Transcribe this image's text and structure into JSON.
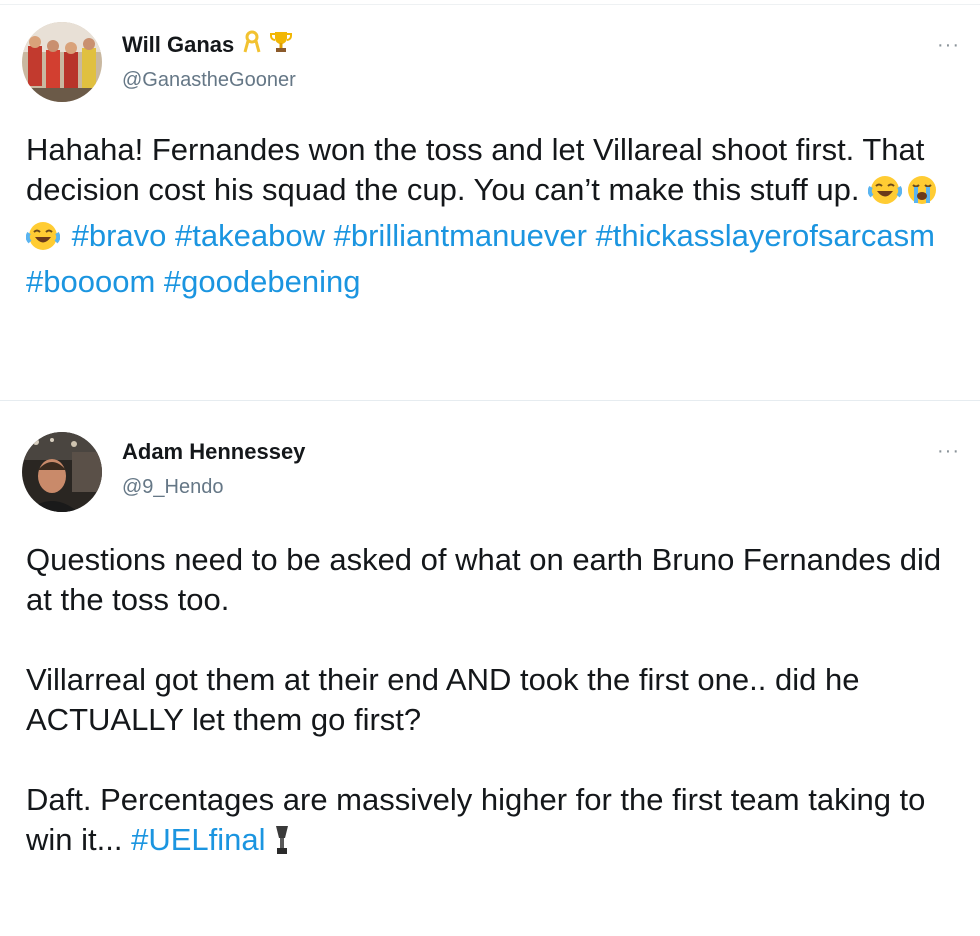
{
  "tweets": [
    {
      "display_name": "Will Ganas",
      "handle": "@GanastheGooner",
      "more_label": "···",
      "text_before": "Hahaha! Fernandes won the toss and let Villareal shoot first. That decision cost his squad the cup. You can’t make this stuff up.",
      "hashtags": [
        "#bravo",
        "#takeabow",
        "#brilliantmanuever",
        "#thickasslayerofsarcasm",
        "#boooom",
        "#goodebening"
      ],
      "emojis": [
        "face-with-tears-of-joy",
        "loudly-crying-face",
        "face-with-tears-of-joy"
      ],
      "badges": [
        "yellow-ribbon",
        "trophy"
      ]
    },
    {
      "display_name": "Adam Hennessey",
      "handle": "@9_Hendo",
      "more_label": "···",
      "paragraphs": [
        "Questions need to be asked of what on earth Bruno Fernandes did at the toss too.",
        "Villarreal got them at their end AND took the first one.. did he ACTUALLY let them go first?",
        "Daft. Percentages are massively higher for the first team taking to win it..."
      ],
      "hashtag": "#UELfinal",
      "trailing_emoji": "trophy"
    }
  ],
  "colors": {
    "hashtag": "#1b95e0",
    "text": "#14171a",
    "handle": "#657786"
  }
}
